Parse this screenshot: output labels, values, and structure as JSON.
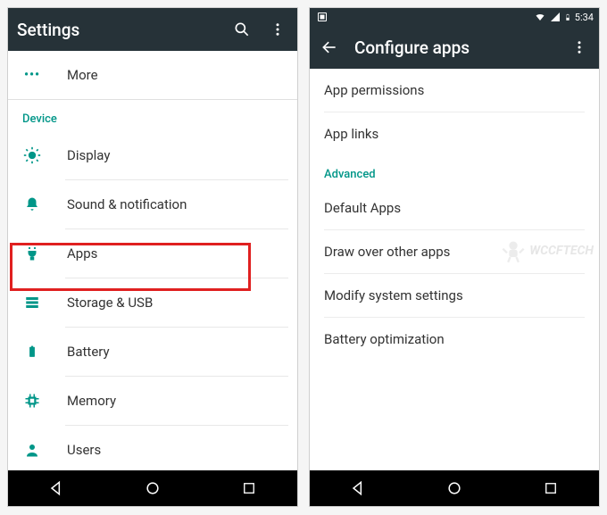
{
  "left": {
    "status_bar": {
      "visible": false
    },
    "app_bar": {
      "title": "Settings"
    },
    "rows": {
      "more": "More",
      "section_device": "Device",
      "display": "Display",
      "sound": "Sound & notification",
      "apps": "Apps",
      "storage": "Storage & USB",
      "battery": "Battery",
      "memory": "Memory",
      "users": "Users"
    },
    "highlighted_row": "apps"
  },
  "right": {
    "status_bar": {
      "time": "5:34"
    },
    "app_bar": {
      "title": "Configure apps"
    },
    "rows": {
      "app_permissions": "App permissions",
      "app_links": "App links",
      "section_advanced": "Advanced",
      "default_apps": "Default Apps",
      "draw_over": "Draw over other apps",
      "modify_system": "Modify system settings",
      "battery_opt": "Battery optimization"
    }
  },
  "watermark": "WCCFTECH",
  "colors": {
    "accent": "#009688",
    "appbar": "#263238",
    "highlight": "#e02020"
  }
}
